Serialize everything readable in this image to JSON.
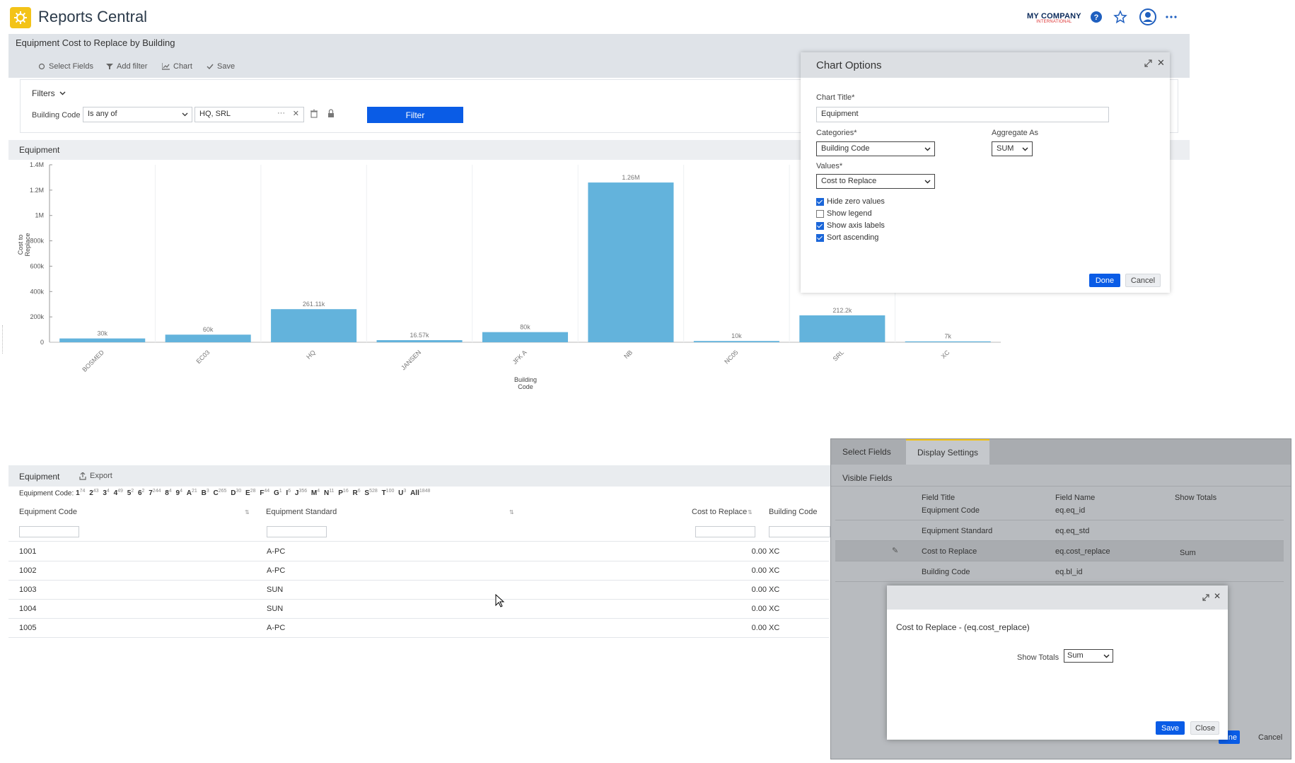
{
  "app": {
    "title": "Reports Central",
    "company_name": "MY COMPANY",
    "company_sub": "INTERNATIONAL"
  },
  "report": {
    "title": "Equipment Cost to Replace by Building",
    "toolbar": {
      "select_fields": "Select Fields",
      "add_filter": "Add filter",
      "chart": "Chart",
      "save": "Save"
    }
  },
  "filters": {
    "toggle_label": "Filters",
    "field_label": "Building Code",
    "operator": "Is any of",
    "value": "HQ, SRL",
    "filter_button": "Filter"
  },
  "chart_panel": {
    "title": "Equipment"
  },
  "chart_data": {
    "type": "bar",
    "title": "Equipment",
    "xlabel": "Building Code",
    "ylabel": "Cost to Replace",
    "categories": [
      "BOSMED",
      "EC03",
      "HQ",
      "JANSEN",
      "JFK A",
      "NB",
      "NC05",
      "SRL",
      "XC"
    ],
    "values": [
      30000,
      60000,
      261110,
      16570,
      80000,
      1260000,
      10000,
      212200,
      7000
    ],
    "data_labels": [
      "30k",
      "60k",
      "261.11k",
      "16.57k",
      "80k",
      "1.26M",
      "10k",
      "212.2k",
      "7k"
    ],
    "ylim": [
      0,
      1400000
    ],
    "yticks": [
      0,
      200000,
      400000,
      600000,
      800000,
      1000000,
      1200000,
      1400000
    ],
    "ytick_labels": [
      "0",
      "200k",
      "400k",
      "600k",
      "800k",
      "1M",
      "1.2M",
      "1.4M"
    ],
    "grid": true,
    "color": "#63b3dc"
  },
  "grid": {
    "title": "Equipment",
    "export_label": "Export",
    "letter_prefix": "Equipment Code:",
    "letters": [
      {
        "l": "1",
        "c": "74"
      },
      {
        "l": "2",
        "c": "43"
      },
      {
        "l": "3",
        "c": "4"
      },
      {
        "l": "4",
        "c": "49"
      },
      {
        "l": "5",
        "c": "2"
      },
      {
        "l": "6",
        "c": "2"
      },
      {
        "l": "7",
        "c": "244"
      },
      {
        "l": "8",
        "c": "4"
      },
      {
        "l": "9",
        "c": "4"
      },
      {
        "l": "A",
        "c": "21"
      },
      {
        "l": "B",
        "c": "3"
      },
      {
        "l": "C",
        "c": "265"
      },
      {
        "l": "D",
        "c": "30"
      },
      {
        "l": "E",
        "c": "28"
      },
      {
        "l": "F",
        "c": "44"
      },
      {
        "l": "G",
        "c": "1"
      },
      {
        "l": "I",
        "c": "6"
      },
      {
        "l": "J",
        "c": "356"
      },
      {
        "l": "M",
        "c": "4"
      },
      {
        "l": "N",
        "c": "11"
      },
      {
        "l": "P",
        "c": "16"
      },
      {
        "l": "R",
        "c": "6"
      },
      {
        "l": "S",
        "c": "528"
      },
      {
        "l": "T",
        "c": "100"
      },
      {
        "l": "U",
        "c": "3"
      },
      {
        "l": "All",
        "c": "1848"
      }
    ],
    "columns": {
      "code": "Equipment Code",
      "standard": "Equipment Standard",
      "cost": "Cost to Replace",
      "building": "Building Code"
    },
    "rows": [
      {
        "code": "1001",
        "standard": "A-PC",
        "cost": "0.00",
        "building": "XC"
      },
      {
        "code": "1002",
        "standard": "A-PC",
        "cost": "0.00",
        "building": "XC"
      },
      {
        "code": "1003",
        "standard": "SUN",
        "cost": "0.00",
        "building": "XC"
      },
      {
        "code": "1004",
        "standard": "SUN",
        "cost": "0.00",
        "building": "XC"
      },
      {
        "code": "1005",
        "standard": "A-PC",
        "cost": "0.00",
        "building": "XC"
      }
    ]
  },
  "chart_options": {
    "title": "Chart Options",
    "chart_title_label": "Chart Title*",
    "chart_title_value": "Equipment",
    "categories_label": "Categories*",
    "categories_value": "Building Code",
    "aggregate_label": "Aggregate As",
    "aggregate_value": "SUM",
    "values_label": "Values*",
    "values_value": "Cost to Replace",
    "checks": [
      {
        "label": "Hide zero values",
        "checked": true
      },
      {
        "label": "Show legend",
        "checked": false
      },
      {
        "label": "Show axis labels",
        "checked": true
      },
      {
        "label": "Sort ascending",
        "checked": true
      }
    ],
    "done": "Done",
    "cancel": "Cancel"
  },
  "display_settings": {
    "tab_select": "Select Fields",
    "tab_display": "Display Settings",
    "section": "Visible Fields",
    "col_title": "Field Title",
    "col_name": "Field Name",
    "col_totals": "Show Totals",
    "rows": [
      {
        "title": "Equipment Code",
        "name": "eq.eq_id",
        "totals": ""
      },
      {
        "title": "Equipment Standard",
        "name": "eq.eq_std",
        "totals": ""
      },
      {
        "title": "Cost to Replace",
        "name": "eq.cost_replace",
        "totals": "Sum"
      },
      {
        "title": "Building Code",
        "name": "eq.bl_id",
        "totals": ""
      }
    ],
    "done_partial": "ne",
    "cancel": "Cancel"
  },
  "totals_modal": {
    "heading": "Cost to Replace - (eq.cost_replace)",
    "show_totals_label": "Show Totals",
    "show_totals_value": "Sum",
    "save": "Save",
    "close": "Close"
  }
}
